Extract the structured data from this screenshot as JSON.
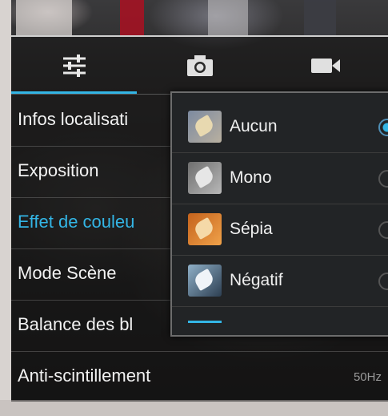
{
  "tabs": [
    {
      "icon": "sliders-icon",
      "label": "Réglages"
    },
    {
      "icon": "camera-icon",
      "label": "Photo"
    },
    {
      "icon": "video-icon",
      "label": "Vidéo"
    }
  ],
  "settings": [
    {
      "label": "Infos localisati",
      "value": ""
    },
    {
      "label": "Exposition",
      "value": ""
    },
    {
      "label": "Effet de couleu",
      "value": ""
    },
    {
      "label": "Mode Scène",
      "value": ""
    },
    {
      "label": "Balance des bl",
      "value": ""
    },
    {
      "label": "Anti-scintillement",
      "value": "50Hz"
    }
  ],
  "color_effect_menu": {
    "options": [
      {
        "label": "Aucun",
        "selected": true
      },
      {
        "label": "Mono",
        "selected": false
      },
      {
        "label": "Sépia",
        "selected": false
      },
      {
        "label": "Négatif",
        "selected": false
      }
    ]
  },
  "colors": {
    "accent": "#33b5e5",
    "text": "#f2f2f2",
    "muted": "#9a9a9a"
  }
}
